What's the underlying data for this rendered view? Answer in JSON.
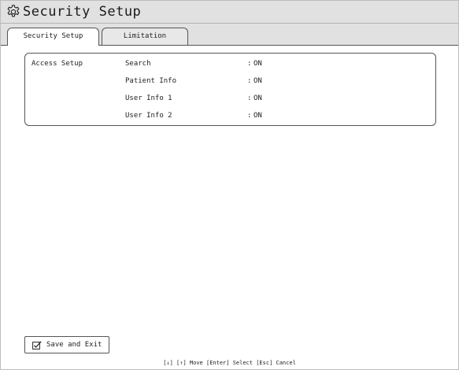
{
  "window": {
    "title": "Security Setup",
    "icon": "gear-icon"
  },
  "tabs": [
    {
      "label": "Security Setup",
      "active": true
    },
    {
      "label": "Limitation",
      "active": false
    }
  ],
  "access_setup": {
    "group_label": "Access Setup",
    "rows": [
      {
        "label": "Search",
        "separator": ":",
        "value": "ON"
      },
      {
        "label": "Patient Info",
        "separator": ":",
        "value": "ON"
      },
      {
        "label": "User Info 1",
        "separator": ":",
        "value": "ON"
      },
      {
        "label": "User Info 2",
        "separator": ":",
        "value": "ON"
      }
    ]
  },
  "footer": {
    "save_button_label": "Save and Exit",
    "save_button_icon": "check-box-icon",
    "help_text": "[↓] [↑] Move  [Enter] Select  [Esc] Cancel"
  },
  "colors": {
    "title_bar": "#e1e1e1",
    "border": "#555555",
    "background": "#ffffff"
  }
}
